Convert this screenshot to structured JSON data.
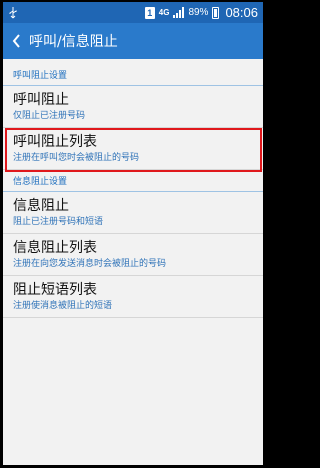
{
  "status_bar": {
    "sim_label": "1",
    "network_label": "4G",
    "battery_percent": "89%",
    "time": "08:06"
  },
  "action_bar": {
    "title": "呼叫/信息阻止"
  },
  "sections": [
    {
      "header": "呼叫阻止设置",
      "items": [
        {
          "title": "呼叫阻止",
          "subtitle": "仅阻止已注册号码"
        },
        {
          "title": "呼叫阻止列表",
          "subtitle": "注册在呼叫您时会被阻止的号码"
        }
      ]
    },
    {
      "header": "信息阻止设置",
      "items": [
        {
          "title": "信息阻止",
          "subtitle": "阻止已注册号码和短语"
        },
        {
          "title": "信息阻止列表",
          "subtitle": "注册在向您发送消息时会被阻止的号码"
        },
        {
          "title": "阻止短语列表",
          "subtitle": "注册使消息被阻止的短语"
        }
      ]
    }
  ]
}
